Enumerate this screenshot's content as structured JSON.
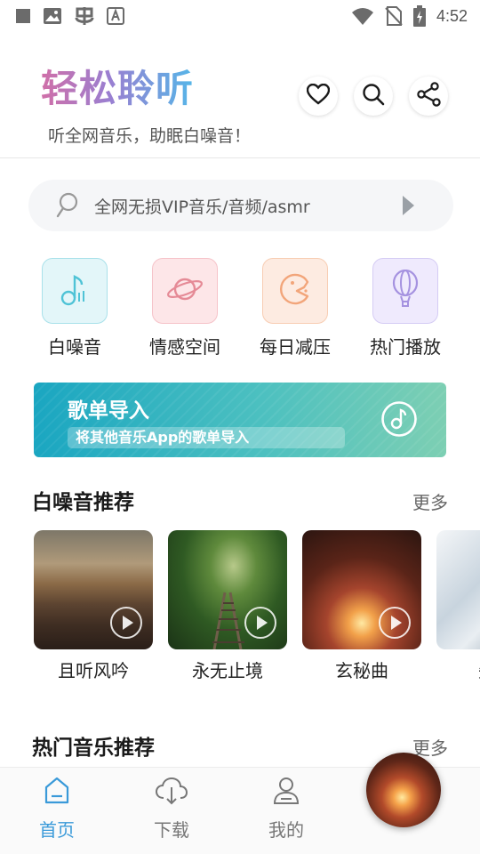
{
  "status_bar": {
    "time": "4:52",
    "left_icons": [
      "stop-square-icon",
      "image-icon",
      "bug-icon",
      "font-icon"
    ],
    "right_icons": [
      "wifi-icon",
      "no-sim-icon",
      "battery-charging-icon"
    ]
  },
  "header": {
    "title": "轻松聆听",
    "subtitle": "听全网音乐，助眠白噪音！",
    "actions": [
      "heart-icon",
      "search-icon",
      "share-icon"
    ]
  },
  "search": {
    "placeholder": "全网无损VIP音乐/音频/asmr"
  },
  "categories": [
    {
      "label": "白噪音",
      "icon": "music-note-icon",
      "color": "#4fc3d6",
      "bg": "#e3f6f9"
    },
    {
      "label": "情感空间",
      "icon": "planet-icon",
      "color": "#e58a96",
      "bg": "#fde6e8"
    },
    {
      "label": "每日减压",
      "icon": "pacman-icon",
      "color": "#f2a57a",
      "bg": "#fdebe1"
    },
    {
      "label": "热门播放",
      "icon": "balloon-icon",
      "color": "#a592e0",
      "bg": "#efeafd"
    }
  ],
  "import_banner": {
    "title": "歌单导入",
    "subtitle": "将其他音乐App的歌单导入",
    "icon": "music-disc-icon"
  },
  "white_noise_section": {
    "title": "白噪音推荐",
    "more": "更多",
    "items": [
      {
        "title": "且听风吟",
        "image": "canyon-sunset"
      },
      {
        "title": "永无止境",
        "image": "forest-railway"
      },
      {
        "title": "玄秘曲",
        "image": "glowing-forest"
      },
      {
        "title": "失重",
        "image": "snowy-scene"
      }
    ]
  },
  "hot_music_section": {
    "title": "热门音乐推荐",
    "more": "更多"
  },
  "bottom_nav": {
    "items": [
      {
        "label": "首页",
        "icon": "home-icon",
        "active": true
      },
      {
        "label": "下载",
        "icon": "cloud-download-icon",
        "active": false
      },
      {
        "label": "我的",
        "icon": "user-icon",
        "active": false
      }
    ]
  },
  "colors": {
    "accent": "#3a9ad9",
    "title_gradient": [
      "#d06fa8",
      "#9a7fd1",
      "#55b6e8"
    ],
    "banner_gradient": [
      "#1aa6c1",
      "#7dcfb3"
    ]
  }
}
